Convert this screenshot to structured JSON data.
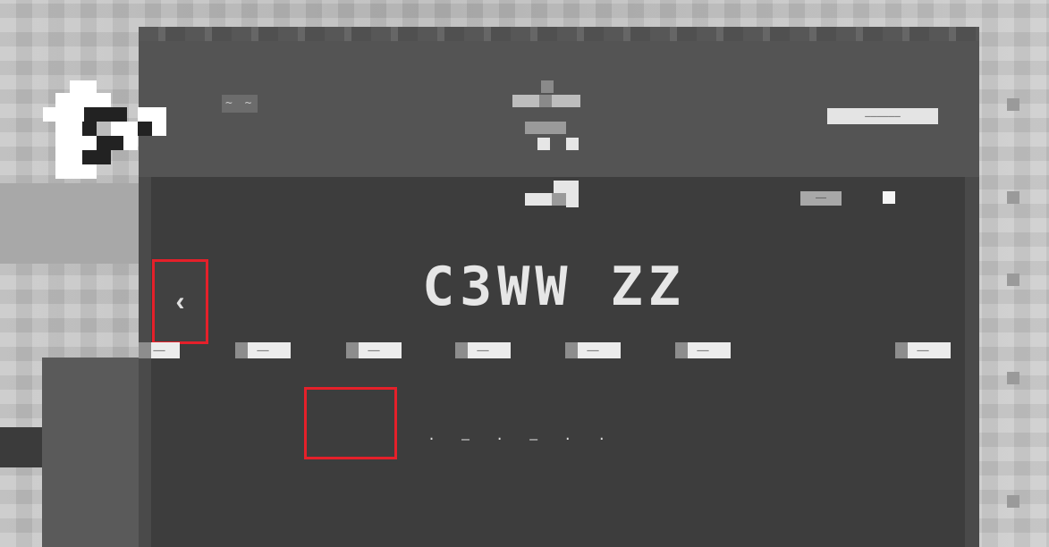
{
  "window": {
    "header_left_text": "~ ~",
    "header_right_text": "——————"
  },
  "content": {
    "right_label": "——",
    "title": "C3WW ZZ",
    "subtitle": "· — · — · ·",
    "back_button_label": "‹"
  },
  "nav": {
    "items": [
      {
        "label": "——"
      },
      {
        "label": "——"
      },
      {
        "label": "——"
      },
      {
        "label": "——"
      },
      {
        "label": "——"
      },
      {
        "label": "——"
      },
      {
        "label": "——"
      }
    ]
  },
  "icons": {
    "mascot": "cow-mascot-icon",
    "header_glyph": "menu-glyph-icon",
    "content_top_glyph": "small-glyph-icon"
  },
  "colors": {
    "highlight": "#e5202a",
    "window": "#4a4a4a",
    "content": "#3d3d3d",
    "text": "#e6e6e6"
  }
}
